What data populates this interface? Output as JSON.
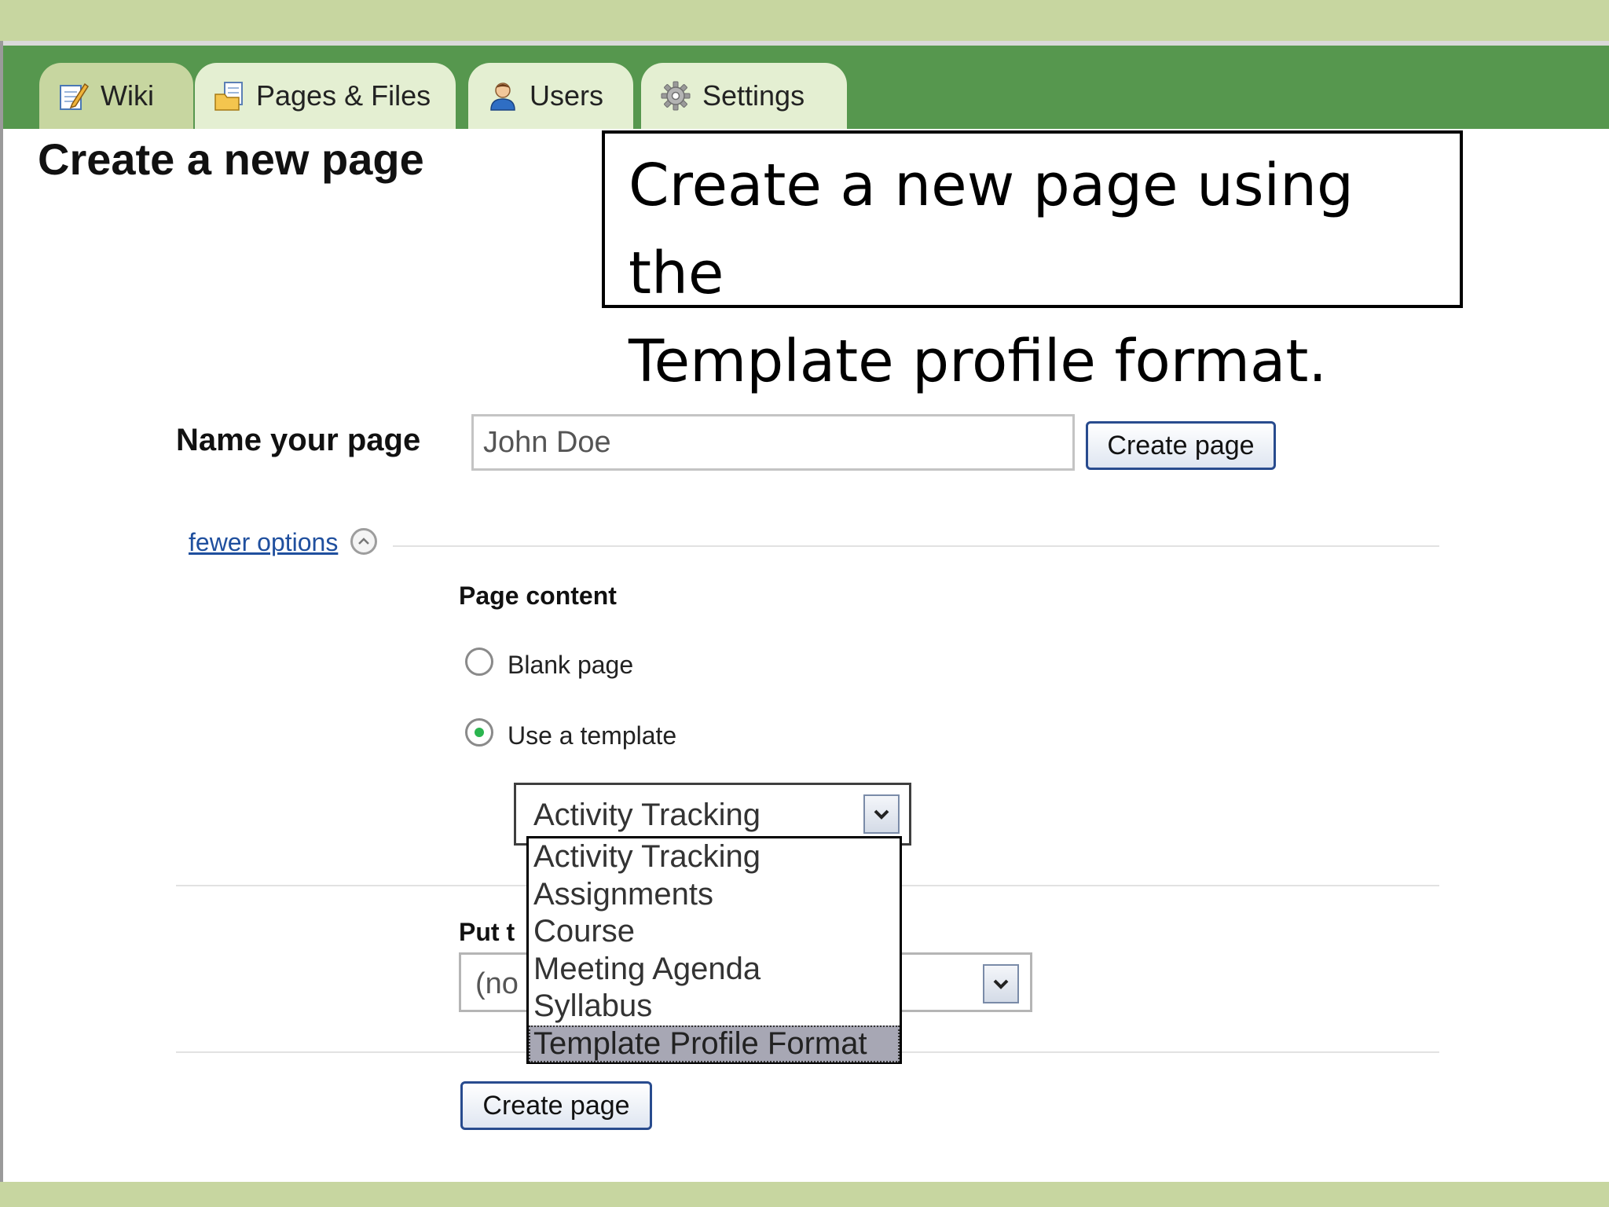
{
  "tabs": [
    {
      "label": "Wiki",
      "icon": "wiki-edit-icon",
      "active": true
    },
    {
      "label": "Pages & Files",
      "icon": "pages-files-icon",
      "active": false
    },
    {
      "label": "Users",
      "icon": "users-icon",
      "active": false
    },
    {
      "label": "Settings",
      "icon": "gear-icon",
      "active": false
    }
  ],
  "page_title": "Create a new page",
  "callout": {
    "line1": "Create a new page using the",
    "line2": "Template profile format."
  },
  "name_section": {
    "label": "Name your page",
    "value": "John Doe",
    "button": "Create page"
  },
  "options_toggle": "fewer options",
  "page_content": {
    "label": "Page content",
    "options": [
      {
        "label": "Blank page",
        "checked": false
      },
      {
        "label": "Use a template",
        "checked": true
      }
    ]
  },
  "template_select": {
    "selected": "Activity Tracking",
    "options": [
      "Activity Tracking",
      "Assignments",
      "Course",
      "Meeting Agenda",
      "Syllabus",
      "Template Profile Format"
    ],
    "highlighted": "Template Profile Format"
  },
  "location": {
    "label": "Put t",
    "value": "(no"
  },
  "bottom_button": "Create page",
  "colors": {
    "tabbar": "#56974e",
    "background": "#c7d6a0",
    "tab": "#e4efd2",
    "link": "#1f4f9e",
    "button_border": "#284b8e"
  }
}
